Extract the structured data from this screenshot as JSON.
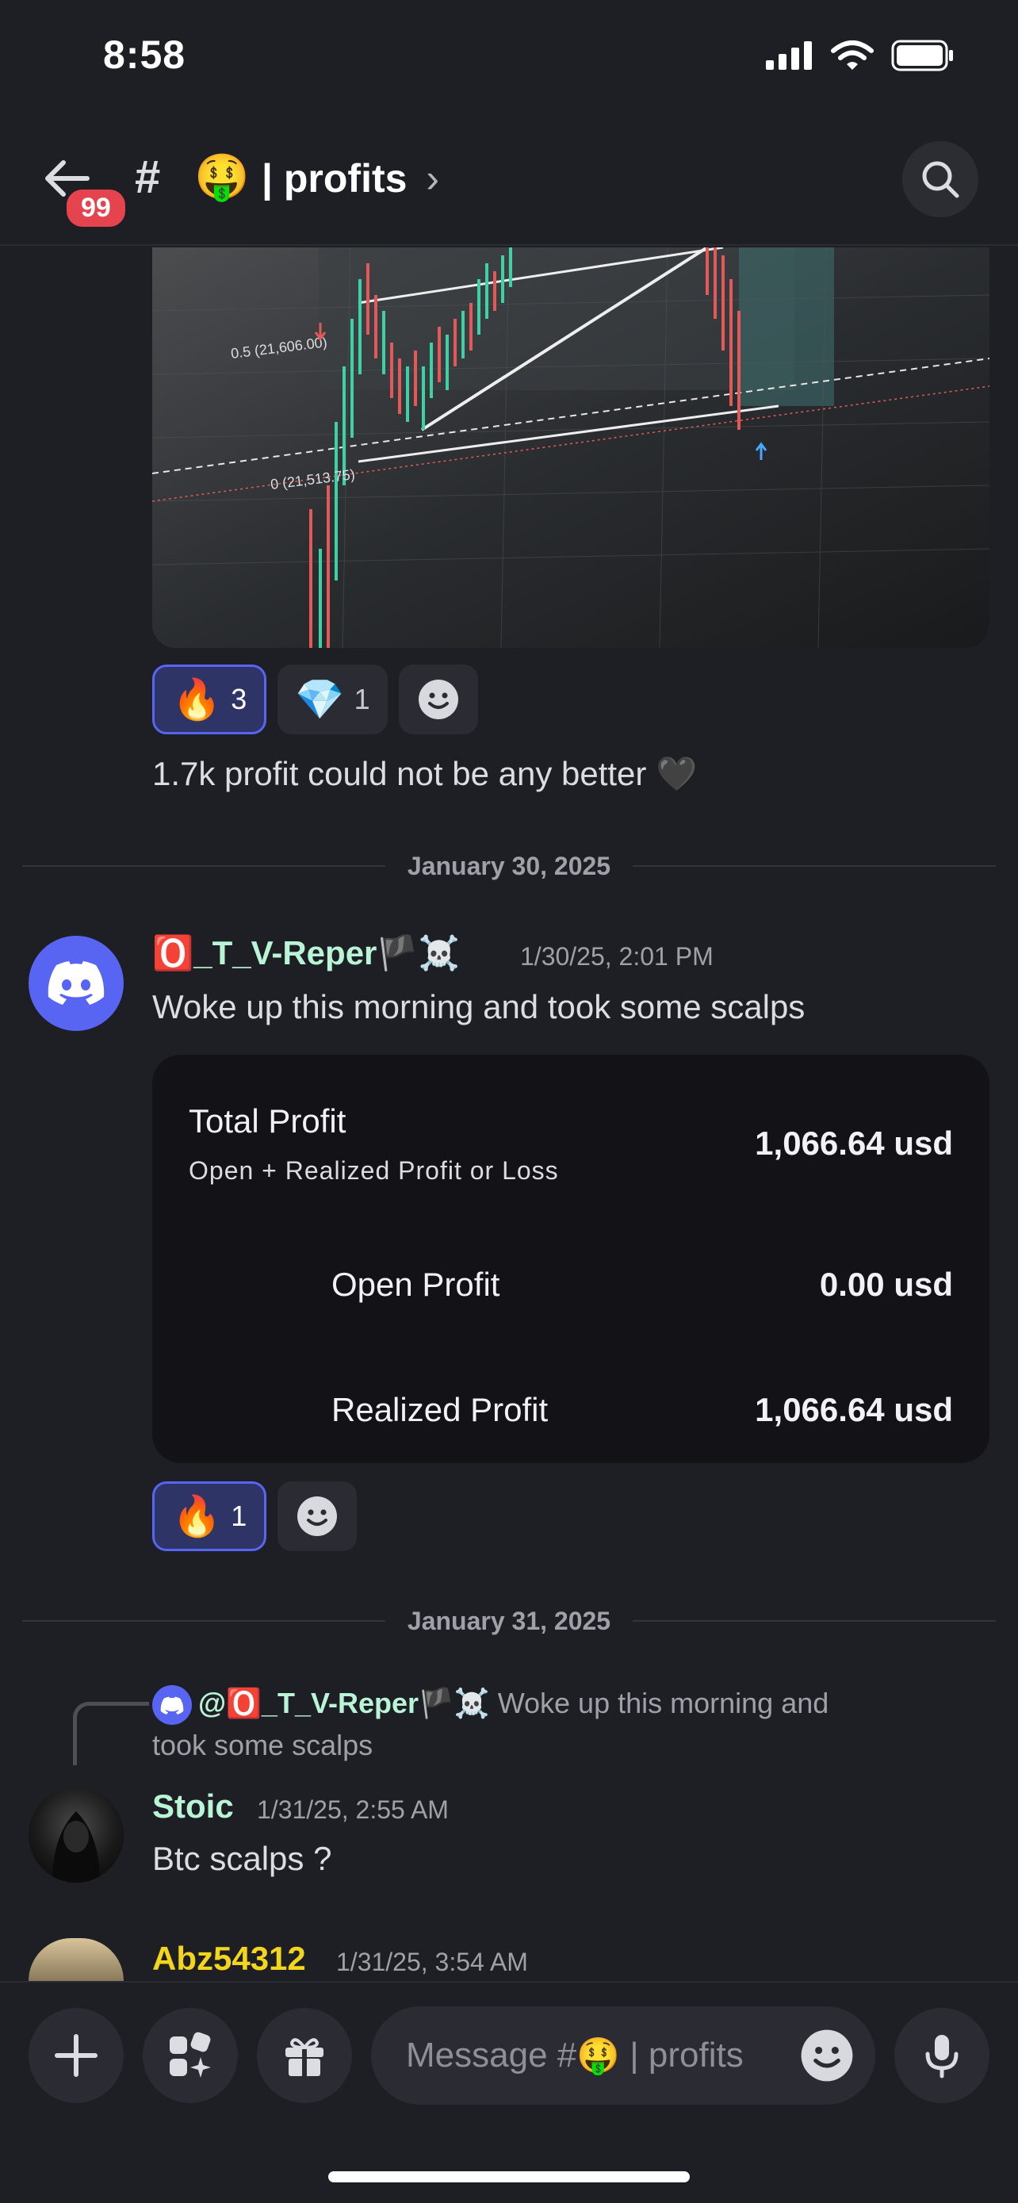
{
  "status": {
    "time": "8:58"
  },
  "header": {
    "badge": "99",
    "hash": "#",
    "emoji": "🤑",
    "channel": "| profits",
    "chevron": "›"
  },
  "message1": {
    "reactions": [
      {
        "emoji": "🔥",
        "count": "3"
      },
      {
        "emoji": "💎",
        "count": "1"
      }
    ],
    "text": "1.7k profit could not be any better 🖤"
  },
  "chart_image": {
    "label_top": "0.5 (21,606.00)",
    "label_bottom": "0 (21,513.75)"
  },
  "divider1": "January 30, 2025",
  "message2": {
    "badge_emoji": "🅾️",
    "username": "_T_V-Reper",
    "name_suffix": "🏴☠️",
    "timestamp": "1/30/25, 2:01 PM",
    "text": "Woke up this morning and took some scalps",
    "card": {
      "total_label": "Total Profit",
      "total_sub": "Open + Realized Profit or Loss",
      "total_value": "1,066.64 usd",
      "open_label": "Open Profit",
      "open_value": "0.00 usd",
      "realized_label": "Realized Profit",
      "realized_value": "1,066.64 usd"
    },
    "reactions": [
      {
        "emoji": "🔥",
        "count": "1"
      }
    ]
  },
  "divider2": "January 31, 2025",
  "reply": {
    "mention": "@🅾️_T_V-Reper🏴☠️",
    "preview_line1": "Woke up this morning and",
    "preview_line2": "took some scalps"
  },
  "message3": {
    "username": "Stoic",
    "timestamp": "1/31/25, 2:55 AM",
    "text": "Btc scalps ?"
  },
  "message4": {
    "username": "Abz54312",
    "timestamp": "1/31/25, 3:54 AM"
  },
  "composer": {
    "placeholder_prefix": "Message #",
    "placeholder_emoji": "🤑",
    "placeholder_suffix": " | profits"
  },
  "colors": {
    "background": "#1e1f24",
    "accent": "#5865f2",
    "username_green": "#b9f4d6",
    "username_yellow": "#f3d51c",
    "badge_red": "#e5444e"
  }
}
